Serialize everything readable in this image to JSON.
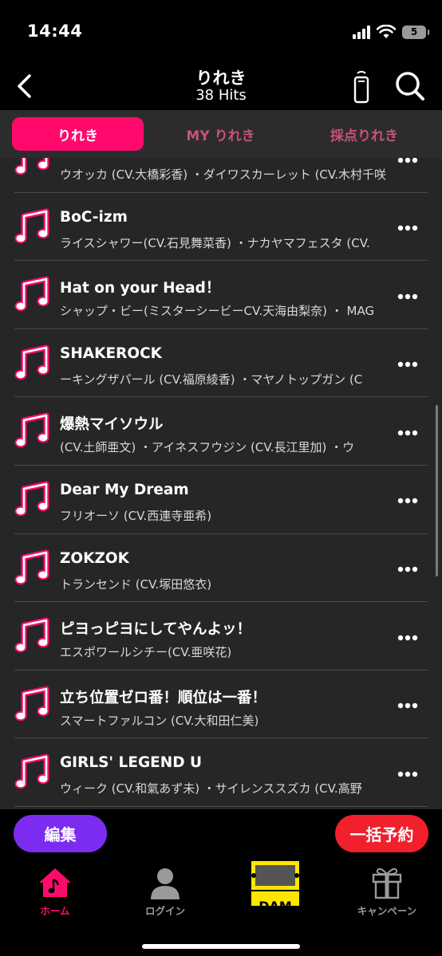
{
  "status": {
    "time": "14:44",
    "battery": "5"
  },
  "header": {
    "title": "りれき",
    "hits": "38 Hits"
  },
  "tabs": [
    {
      "label": "りれき",
      "active": true
    },
    {
      "label": "MY りれき",
      "active": false
    },
    {
      "label": "採点りれき",
      "active": false
    }
  ],
  "songs": [
    {
      "title": "",
      "artist": "ウオッカ (CV.大橋彩香) ・ダイワスカーレット (CV.木村千咲)"
    },
    {
      "title": "BoC-izm",
      "artist": "ライスシャワー(CV.石見舞菜香) ・ナカヤマフェスタ (CV."
    },
    {
      "title": "Hat on your Head！",
      "artist": "シャップ・ビー(ミスターシービーCV.天海由梨奈) ・ MAG"
    },
    {
      "title": "SHAKEROCK",
      "artist": "ーキングザパール (CV.福原綾香) ・マヤノトップガン (C"
    },
    {
      "title": "爆熱マイソウル",
      "artist": "(CV.土師亜文) ・アイネスフウジン (CV.長江里加) ・ウ"
    },
    {
      "title": "Dear My Dream",
      "artist": "フリオーソ (CV.西連寺亜希)"
    },
    {
      "title": "ZOKZOK",
      "artist": "トランセンド (CV.塚田悠衣)"
    },
    {
      "title": "ピヨっピヨにしてやんよッ！",
      "artist": "エスポワールシチー(CV.亜咲花)"
    },
    {
      "title": "立ち位置ゼロ番！順位は一番！",
      "artist": "スマートファルコン (CV.大和田仁美)"
    },
    {
      "title": "GIRLS' LEGEND U",
      "artist": "ウィーク (CV.和氣あず未) ・サイレンススズカ (CV.高野"
    }
  ],
  "actions": {
    "edit": "編集",
    "reserve": "一括予約"
  },
  "nav": [
    {
      "label": "ホーム",
      "icon": "home-note-icon",
      "active": true
    },
    {
      "label": "ログイン",
      "icon": "person-icon",
      "active": false
    },
    {
      "label": "DAM",
      "icon": "dam-logo",
      "active": false
    },
    {
      "label": "キャンペーン",
      "icon": "gift-icon",
      "active": false
    }
  ],
  "colors": {
    "accent": "#ff0a6c",
    "edit": "#7b2cf0",
    "reserve": "#f21f2c",
    "list_bg": "#262626",
    "dam_yellow": "#ffe600"
  }
}
